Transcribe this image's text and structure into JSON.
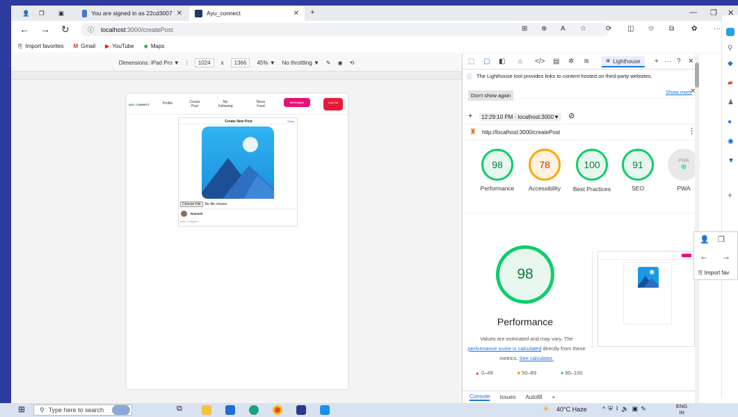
{
  "browser": {
    "tabs": [
      {
        "title": "You are signed in as 22cd3007"
      },
      {
        "title": "Ayu_connect"
      }
    ],
    "url_host": "localhost",
    "url_path": ":3000/createPost",
    "favorites": [
      "Import favorites",
      "Gmail",
      "YouTube",
      "Maps"
    ]
  },
  "device_toolbar": {
    "dimensions": "Dimensions: iPad Pro ▼",
    "width": "1024",
    "x": "x",
    "height": "1366",
    "zoom": "45% ▼",
    "throttle": "No throttling ▼"
  },
  "app": {
    "logo": "AYU_CONNECT",
    "nav": {
      "profile": "Profile",
      "create_post": "Create Post",
      "my_following": "My Following",
      "news_feed": "News Feed",
      "messages": "Messages",
      "logout": "Log Out"
    },
    "card_title": "Create New Post",
    "share": "Share",
    "choose_file": "Choose File",
    "no_file": "No file chosen",
    "username": "Ramesh",
    "caption_placeholder": "write a caption...."
  },
  "devtools": {
    "tab": "Lighthouse",
    "info_text": "The Lighthouse tool provides links to content hosted on third-party websites.",
    "show_more": "Show more",
    "dont_show": "Don't show again",
    "report_time": "12:29:10 PM - localhost:3000▼",
    "report_url": "http://localhost:3000/createPost",
    "scores": [
      {
        "value": "98",
        "label": "Performance"
      },
      {
        "value": "78",
        "label": "Accessibility"
      },
      {
        "value": "100",
        "label": "Best Practices"
      },
      {
        "value": "91",
        "label": "SEO"
      },
      {
        "value": "PWA",
        "label": "PWA"
      }
    ],
    "big_score": "98",
    "big_label": "Performance",
    "note1": "Values are estimated and may vary. The",
    "note_link": "performance score is calculated",
    "note2": "directly from these",
    "note3": "metrics.",
    "calc_link": "See calculator.",
    "legend": [
      "0–49",
      "50–89",
      "90–100"
    ],
    "bottom_tabs": [
      "Console",
      "Issues",
      "Autofill"
    ]
  },
  "popup": {
    "import": "Import fav"
  },
  "taskbar": {
    "search": "Type here to search",
    "weather": "40°C Haze",
    "lang1": "ENG",
    "lang2": "IN"
  },
  "colors": {
    "good": "#0cce6b",
    "average": "#ffa400",
    "poor": "#ff4e42",
    "pink": "#e8107a"
  }
}
